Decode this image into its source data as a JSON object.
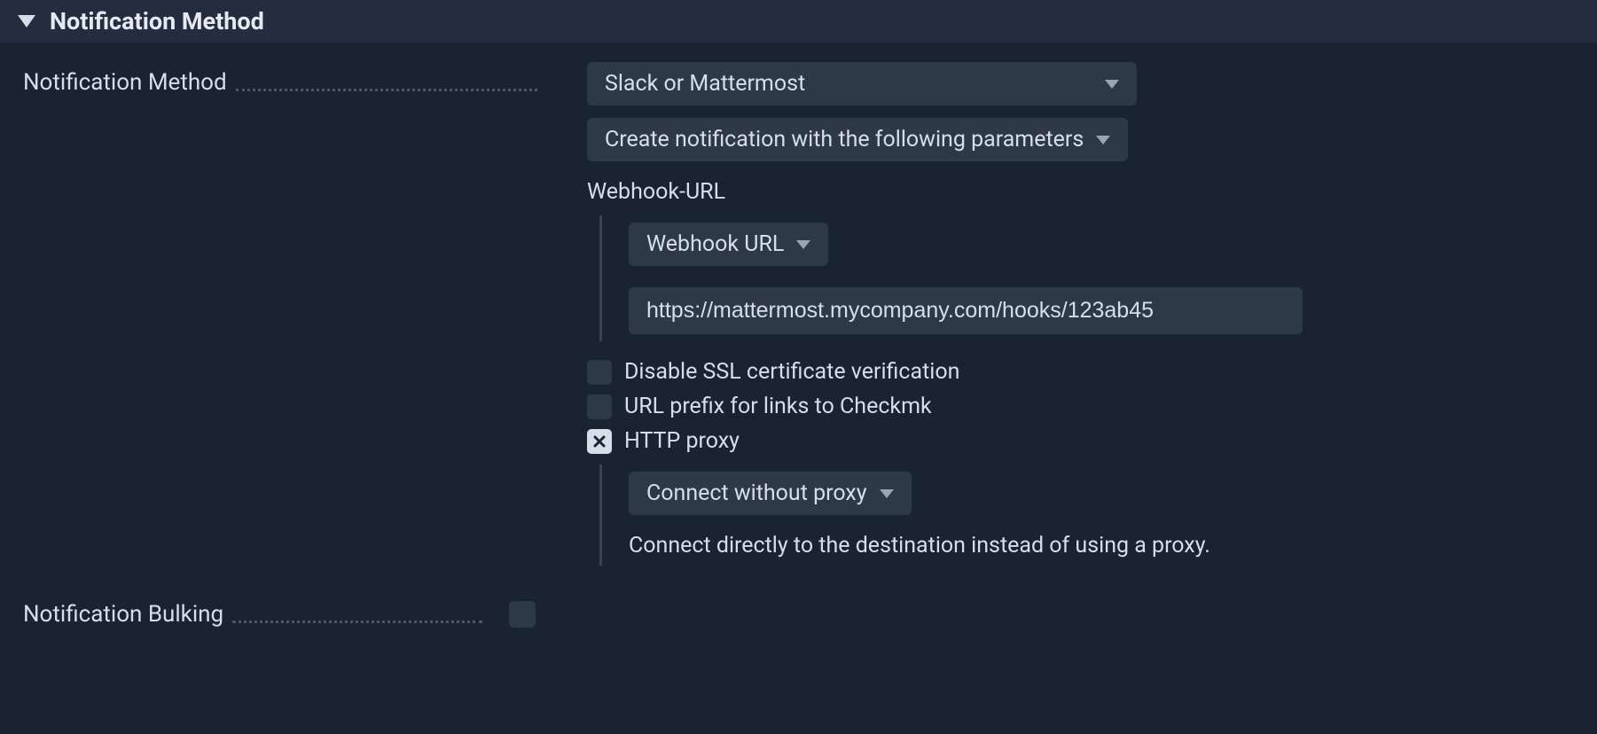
{
  "section": {
    "title": "Notification Method"
  },
  "fields": {
    "notification_method": {
      "label": "Notification Method",
      "method_dropdown": "Slack or Mattermost",
      "params_dropdown": "Create notification with the following parameters",
      "webhook": {
        "section_label": "Webhook-URL",
        "type_dropdown": "Webhook URL",
        "url_value": "https://mattermost.mycompany.com/hooks/123ab45"
      },
      "options": {
        "disable_ssl": "Disable SSL certificate verification",
        "url_prefix": "URL prefix for links to Checkmk",
        "http_proxy": "HTTP proxy"
      },
      "proxy": {
        "dropdown": "Connect without proxy",
        "help": "Connect directly to the destination instead of using a proxy."
      }
    },
    "notification_bulking": {
      "label": "Notification Bulking"
    }
  }
}
